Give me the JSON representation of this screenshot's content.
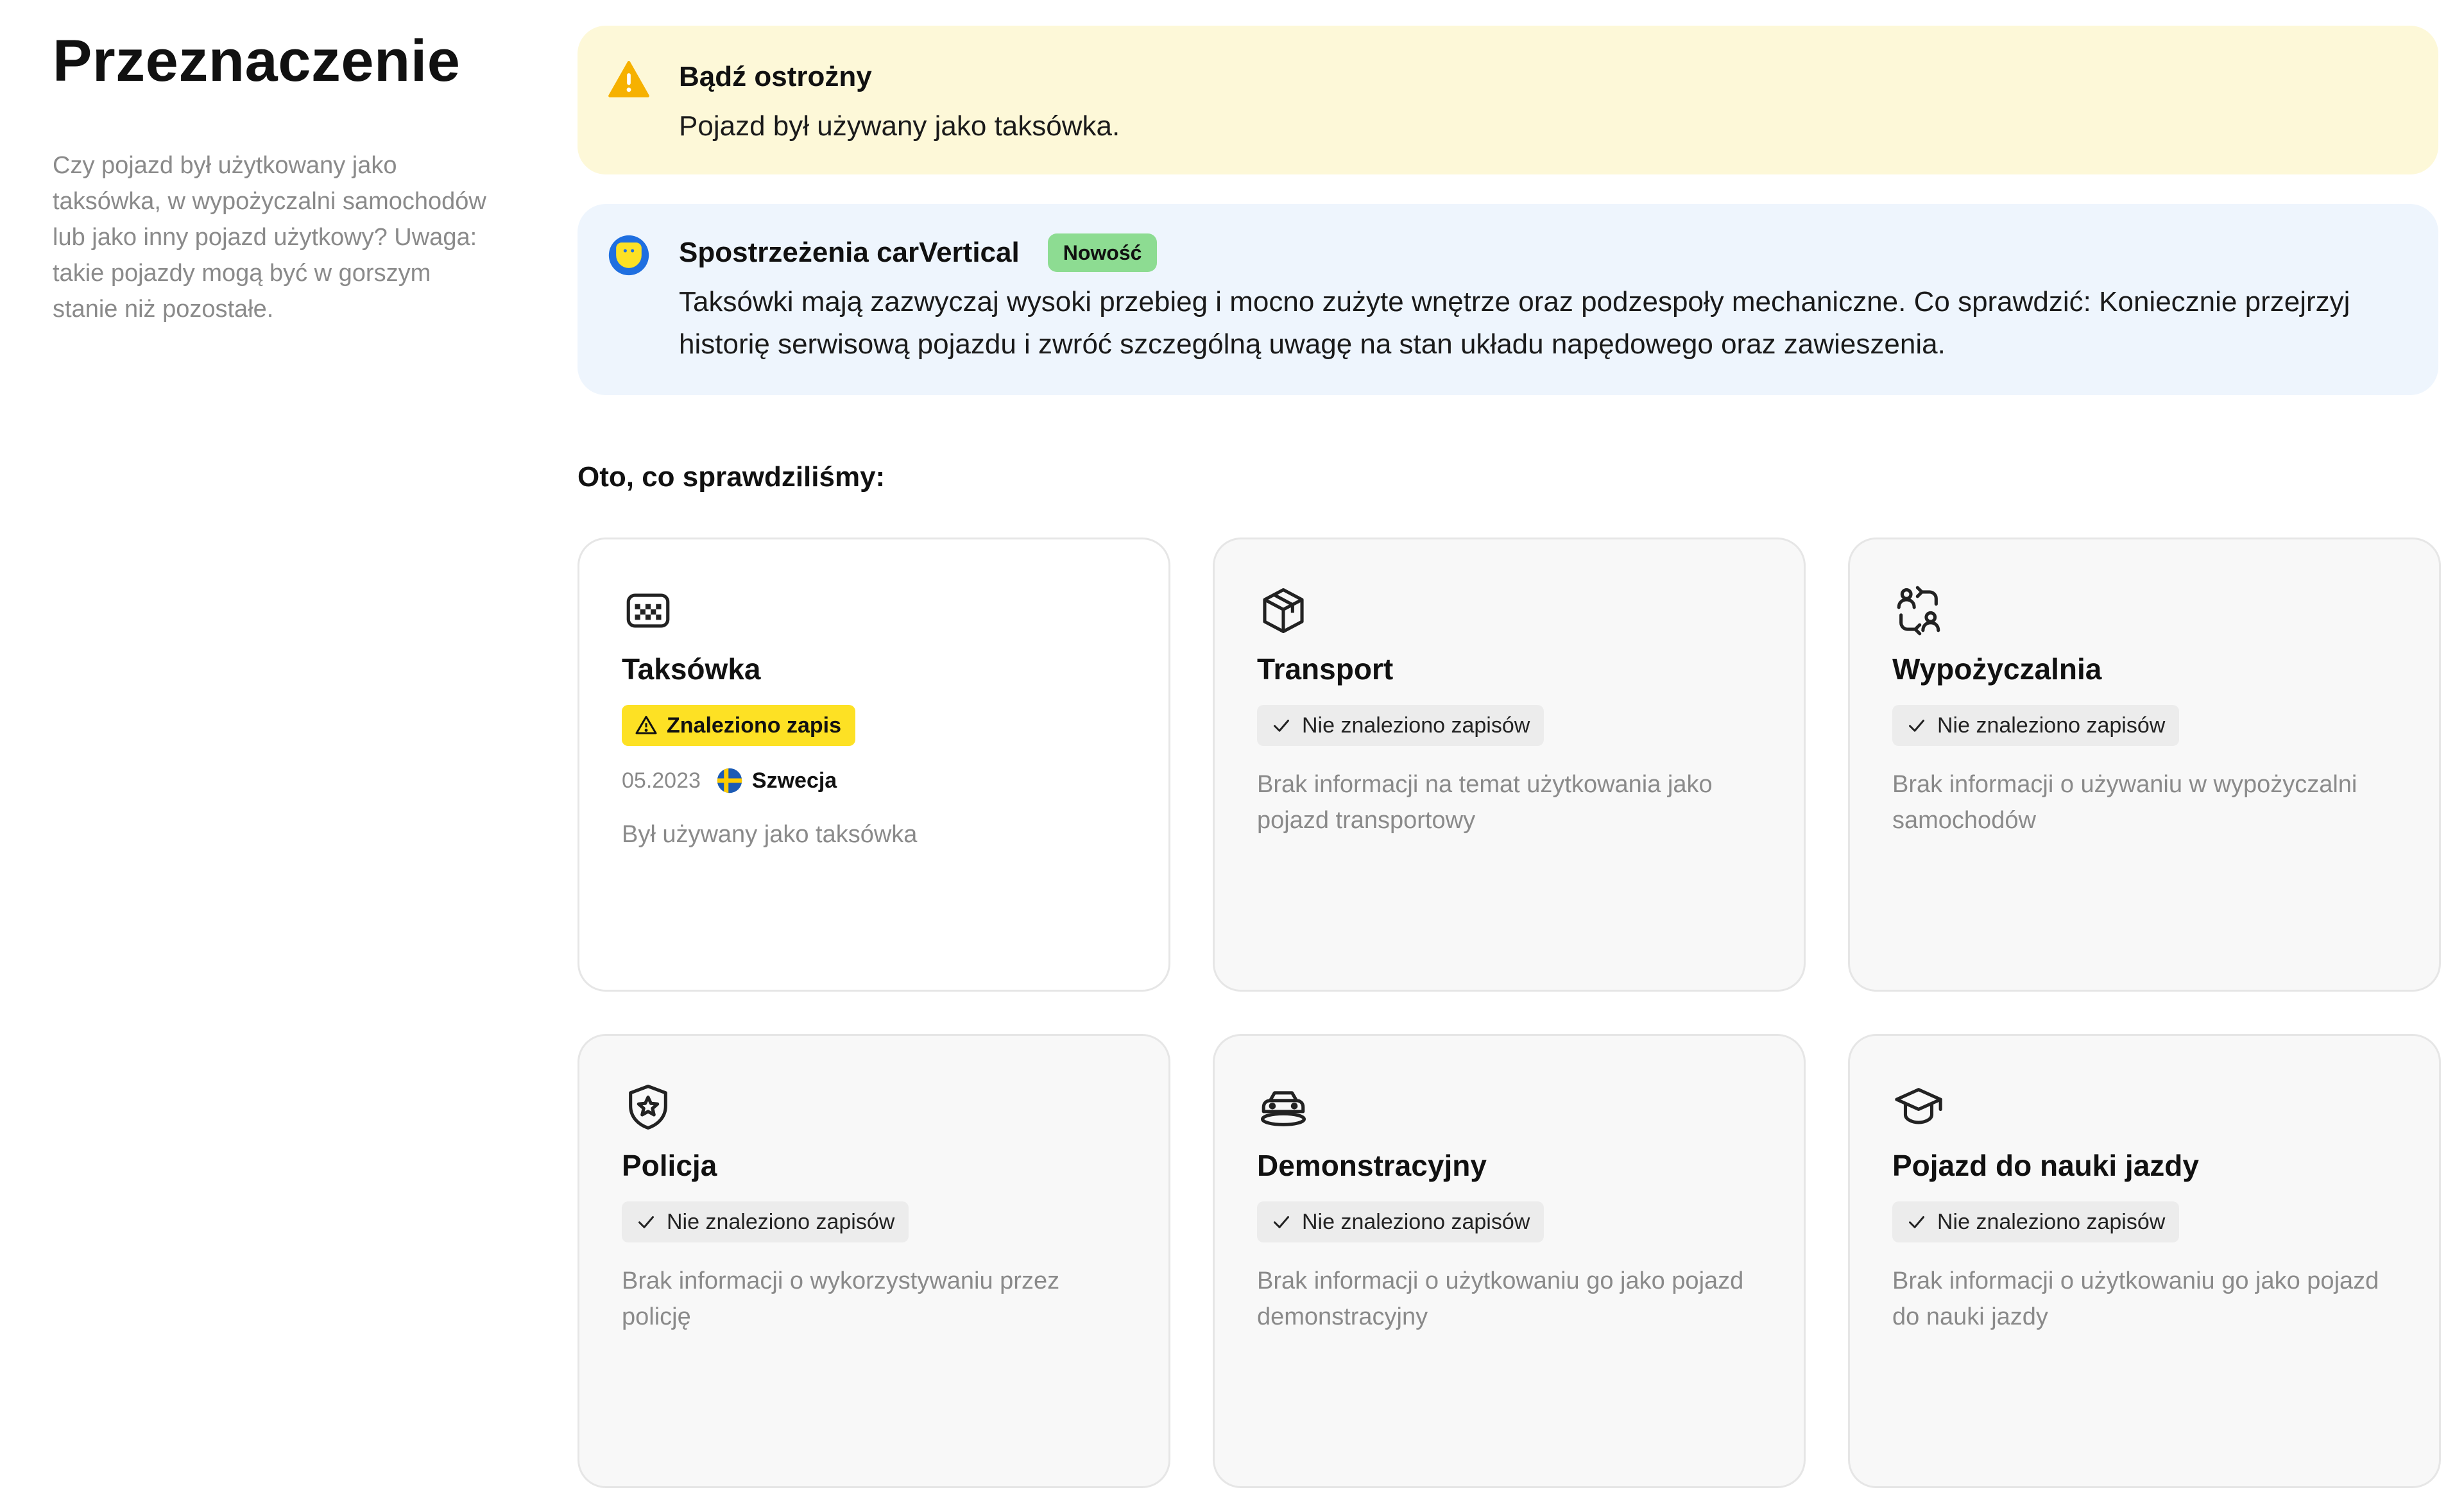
{
  "section": {
    "title": "Przeznaczenie",
    "description": "Czy pojazd był użytkowany jako taksówka, w wypożyczalni samochodów lub jako inny pojazd użytkowy? Uwaga: takie pojazdy mogą być w gorszym stanie niż pozostałe."
  },
  "warning": {
    "title": "Bądź ostrożny",
    "text": "Pojazd był używany jako taksówka.",
    "color": "#fdf8d8",
    "icon": "warning-triangle-icon"
  },
  "insight": {
    "title": "Spostrzeżenia carVertical",
    "badge": "Nowość",
    "text": "Taksówki mają zazwyczaj wysoki przebieg i mocno zużyte wnętrze oraz podzespoły mechaniczne. Co sprawdzić: Koniecznie przejrzyj historię serwisową pojazdu i zwróć szczególną uwagę na stan układu napędowego oraz zawieszenia.",
    "color": "#eef5fd",
    "icon": "carvertical-logo-icon"
  },
  "checked_title": "Oto, co sprawdziliśmy:",
  "cards": [
    {
      "icon": "taxi-icon",
      "title": "Taksówka",
      "status": "Znaleziono zapis",
      "status_type": "found",
      "date": "05.2023",
      "country": "Szwecja",
      "flag": "sweden-flag-icon",
      "description": "Był używany jako taksówka"
    },
    {
      "icon": "box-icon",
      "title": "Transport",
      "status": "Nie znaleziono zapisów",
      "status_type": "none",
      "description": "Brak informacji na temat użytkowania jako pojazd transportowy"
    },
    {
      "icon": "rental-swap-icon",
      "title": "Wypożyczalnia",
      "status": "Nie znaleziono zapisów",
      "status_type": "none",
      "description": "Brak informacji o używaniu w wypożyczalni samochodów"
    },
    {
      "icon": "police-badge-icon",
      "title": "Policja",
      "status": "Nie znaleziono zapisów",
      "status_type": "none",
      "description": "Brak informacji o wykorzystywaniu przez policję"
    },
    {
      "icon": "demo-car-icon",
      "title": "Demonstracyjny",
      "status": "Nie znaleziono zapisów",
      "status_type": "none",
      "description": "Brak informacji o użytkowaniu go jako pojazd demonstracyjny"
    },
    {
      "icon": "graduation-cap-icon",
      "title": "Pojazd do nauki jazdy",
      "status": "Nie znaleziono zapisów",
      "status_type": "none",
      "description": "Brak informacji o użytkowaniu go jako pojazd do nauki jazdy"
    }
  ],
  "colors": {
    "found_badge": "#fde124",
    "new_badge": "#8ddc92",
    "card_bg": "#f8f8f8",
    "muted_text": "#8a8a8a"
  }
}
